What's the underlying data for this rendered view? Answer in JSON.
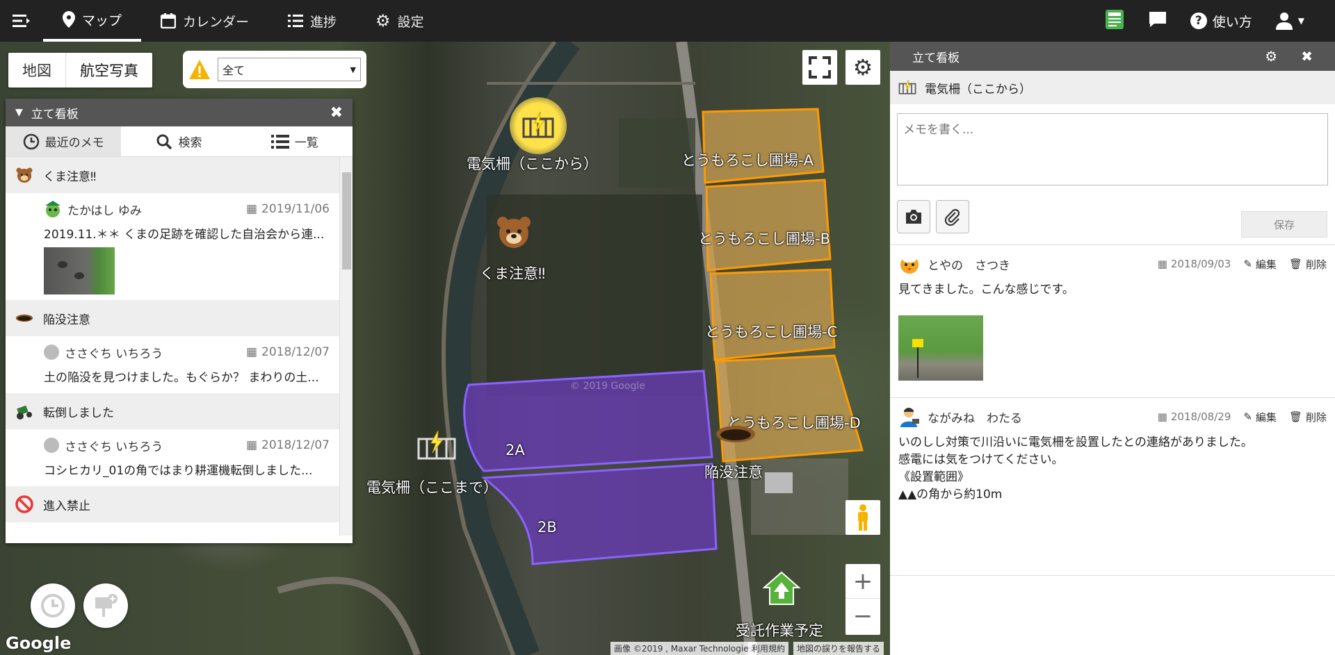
{
  "nav": {
    "items": [
      {
        "label": "マップ"
      },
      {
        "label": "カレンダー"
      },
      {
        "label": "進捗"
      },
      {
        "label": "設定"
      }
    ],
    "help": "使い方"
  },
  "map": {
    "type_tabs": [
      "地図",
      "航空写真"
    ],
    "filter": {
      "value": "全て"
    },
    "labels": {
      "fence_start": "電気柵（ここから）",
      "fence_end": "電気柵（ここまで）",
      "bear": "くま注意‼",
      "sink": "陥没注意",
      "planned": "受託作業予定",
      "corn_a": "とうもろこし圃場-A",
      "corn_b": "とうもろこし圃場-B",
      "corn_c": "とうもろこし圃場-C",
      "corn_d": "とうもろこし圃場-D",
      "field_2a": "2A",
      "field_2b": "2B"
    },
    "google": "Google",
    "attribution": [
      "画像 ©2019 , Maxar Technologies",
      "利用規約",
      "地図の誤りを報告する"
    ],
    "watermark": "© 2019 Google"
  },
  "left_panel": {
    "title": "立て看板",
    "tabs": [
      "最近のメモ",
      "検索",
      "一覧"
    ],
    "groups": [
      {
        "name": "くま注意‼",
        "user": "たかはし ゆみ",
        "date": "2019/11/06",
        "text": "2019.11.＊＊ くまの足跡を確認した自治会から連..."
      },
      {
        "name": "陥没注意",
        "user": "ささぐち いちろう",
        "date": "2018/12/07",
        "text": "土の陥没を見つけました。もぐらか？ まわりの土..."
      },
      {
        "name": "転倒しました",
        "user": "ささぐち いちろう",
        "date": "2018/12/07",
        "text": "コシヒカリ_01の角ではまり耕運機転倒しました..."
      },
      {
        "name": "進入禁止"
      }
    ]
  },
  "right_panel": {
    "title": "立て看板",
    "sign_name": "電気柵（ここから）",
    "memo_placeholder": "メモを書く...",
    "save_label": "保存",
    "entries": [
      {
        "user": "とやの　さつき",
        "date": "2018/09/03",
        "edit": "編集",
        "delete": "削除",
        "text": "見てきました。こんな感じです。"
      },
      {
        "user": "ながみね　わたる",
        "date": "2018/08/29",
        "edit": "編集",
        "delete": "削除",
        "lines": [
          "いのしし対策で川沿いに電気柵を設置したとの連絡がありました。",
          "感電には気をつけてください。",
          "《設置範囲》",
          "▲▲の角から約10m"
        ]
      }
    ]
  }
}
